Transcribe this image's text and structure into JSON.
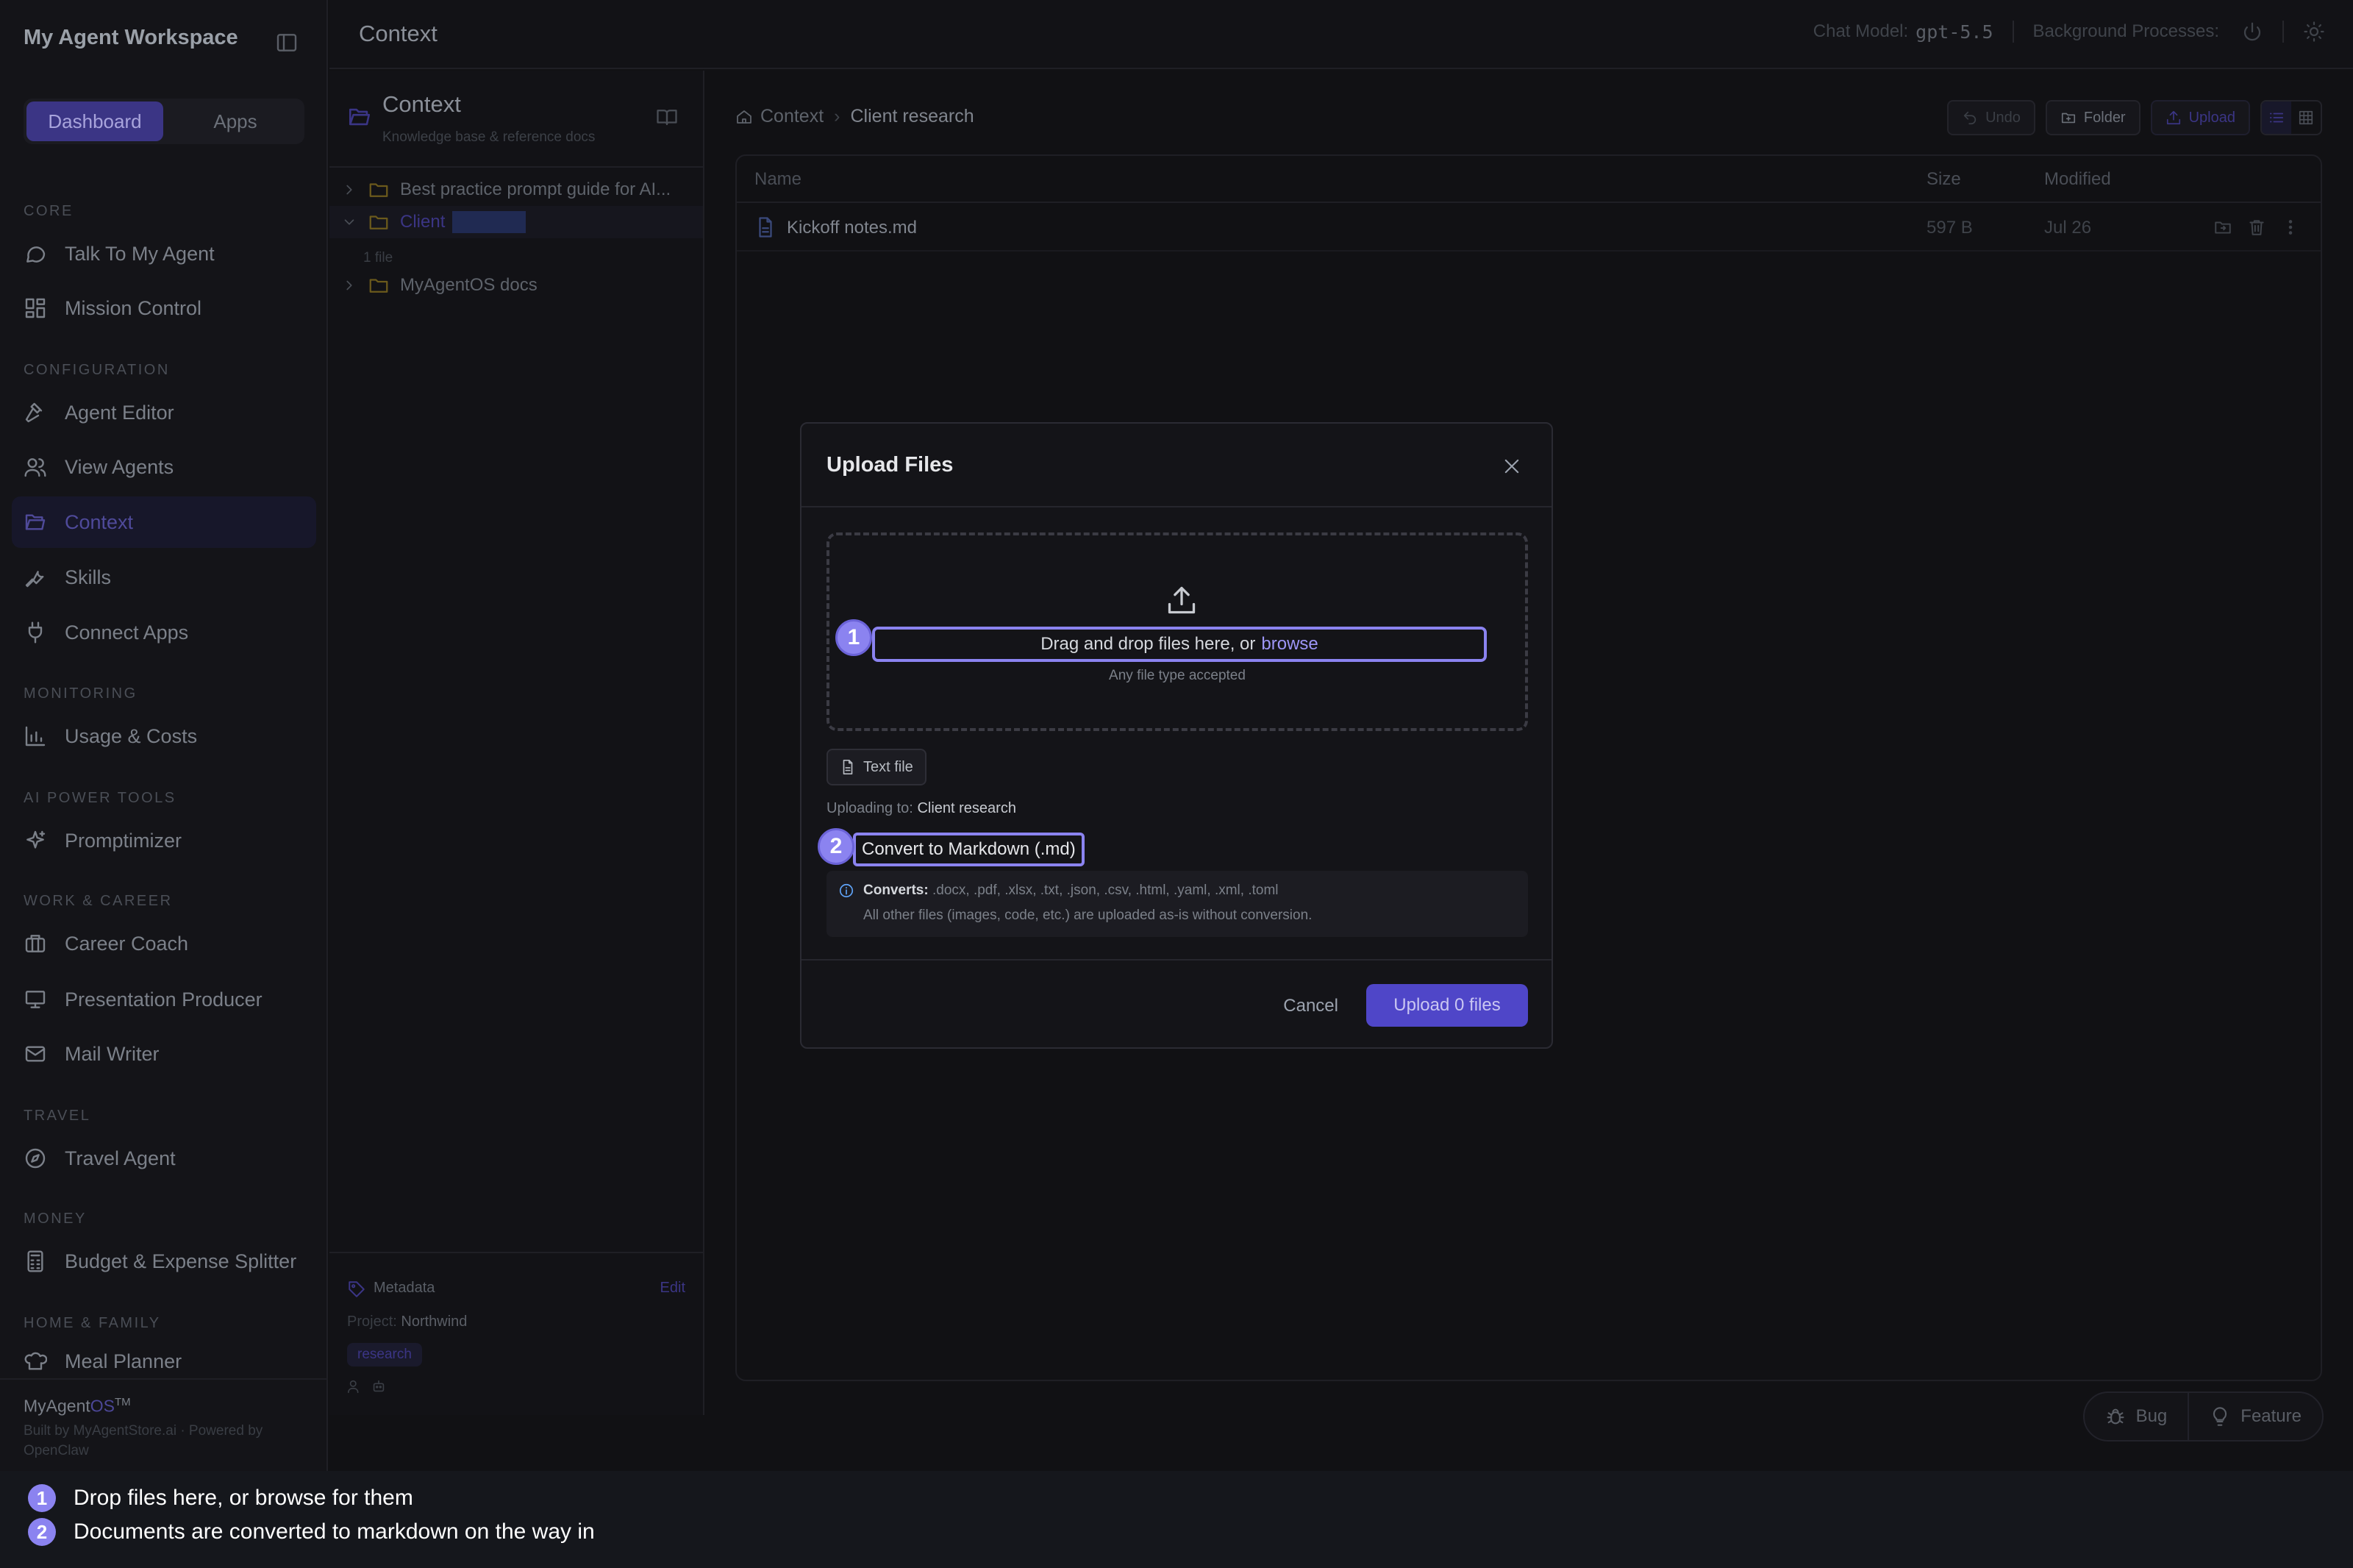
{
  "sidebar": {
    "workspace_title": "My Agent Workspace",
    "tabs": {
      "dashboard": "Dashboard",
      "apps": "Apps"
    },
    "sections": [
      {
        "label": "CORE",
        "items": [
          {
            "label": "Talk To My Agent",
            "icon": "chat-bubble-icon"
          },
          {
            "label": "Mission Control",
            "icon": "grid-icon"
          }
        ]
      },
      {
        "label": "CONFIGURATION",
        "items": [
          {
            "label": "Agent Editor",
            "icon": "hammer-icon"
          },
          {
            "label": "View Agents",
            "icon": "users-icon"
          },
          {
            "label": "Context",
            "icon": "folder-open-icon",
            "active": true
          },
          {
            "label": "Skills",
            "icon": "wrench-icon"
          },
          {
            "label": "Connect Apps",
            "icon": "plug-icon"
          }
        ]
      },
      {
        "label": "MONITORING",
        "items": [
          {
            "label": "Usage & Costs",
            "icon": "bar-chart-icon"
          }
        ]
      },
      {
        "label": "AI POWER TOOLS",
        "items": [
          {
            "label": "Promptimizer",
            "icon": "sparkles-icon"
          }
        ]
      },
      {
        "label": "WORK & CAREER",
        "items": [
          {
            "label": "Career Coach",
            "icon": "briefcase-icon"
          },
          {
            "label": "Presentation Producer",
            "icon": "presentation-icon"
          },
          {
            "label": "Mail Writer",
            "icon": "mail-icon"
          }
        ]
      },
      {
        "label": "TRAVEL",
        "items": [
          {
            "label": "Travel Agent",
            "icon": "compass-icon"
          }
        ]
      },
      {
        "label": "MONEY",
        "items": [
          {
            "label": "Budget & Expense Splitter",
            "icon": "calculator-icon"
          }
        ]
      },
      {
        "label": "HOME & FAMILY",
        "items": [
          {
            "label": "Meal Planner",
            "icon": "chef-hat-icon"
          }
        ]
      }
    ],
    "footer": {
      "brand_prefix": "MyAgent",
      "brand_os": "OS",
      "brand_tm": "TM",
      "built_by": "Built by MyAgentStore.ai · Powered by OpenClaw"
    }
  },
  "topbar": {
    "title": "Context",
    "chat_model_label": "Chat Model:",
    "chat_model_value": "gpt-5.5",
    "background_label": "Background Processes:"
  },
  "context_panel": {
    "title": "Context",
    "subtitle": "Knowledge base & reference docs",
    "tree": [
      {
        "name": "Best practice prompt guide for AI...",
        "expanded": false
      },
      {
        "name": "Client",
        "expanded": true,
        "selected": true,
        "count": "1 file"
      },
      {
        "name": "MyAgentOS docs",
        "expanded": false
      }
    ],
    "metadata": {
      "label": "Metadata",
      "edit": "Edit",
      "project_label": "Project:",
      "project_value": "Northwind",
      "tag": "research"
    }
  },
  "main": {
    "breadcrumb": {
      "root": "Context",
      "current": "Client research"
    },
    "toolbar": {
      "undo": "Undo",
      "folder": "Folder",
      "upload": "Upload"
    },
    "table": {
      "columns": [
        "Name",
        "Size",
        "Modified"
      ],
      "rows": [
        {
          "name": "Kickoff notes.md",
          "size": "597 B",
          "modified": "Jul 26"
        }
      ]
    },
    "feedback": {
      "bug": "Bug",
      "feature": "Feature"
    }
  },
  "dialog": {
    "title": "Upload Files",
    "drop_text": "Drag and drop files here, or",
    "browse": "browse",
    "drop_sub": "Any file type accepted",
    "text_file": "Text file",
    "uploading_to_label": "Uploading to:",
    "uploading_to_value": "Client research",
    "convert_label": "Convert to Markdown (.md)",
    "converts_label": "Converts:",
    "converts_list": ".docx, .pdf, .xlsx, .txt, .json, .csv, .html, .yaml, .xml, .toml",
    "converts_note": "All other files (images, code, etc.) are uploaded as-is without conversion.",
    "cancel": "Cancel",
    "upload_button": "Upload 0 files"
  },
  "annotations": [
    {
      "n": "1",
      "text": "Drop files here, or browse for them"
    },
    {
      "n": "2",
      "text": "Documents are converted to markdown on the way in"
    }
  ],
  "colors": {
    "accent": "#8b83f0",
    "accent_dim": "#3b3585",
    "background": "#111114",
    "folder": "#6b5a1c"
  }
}
